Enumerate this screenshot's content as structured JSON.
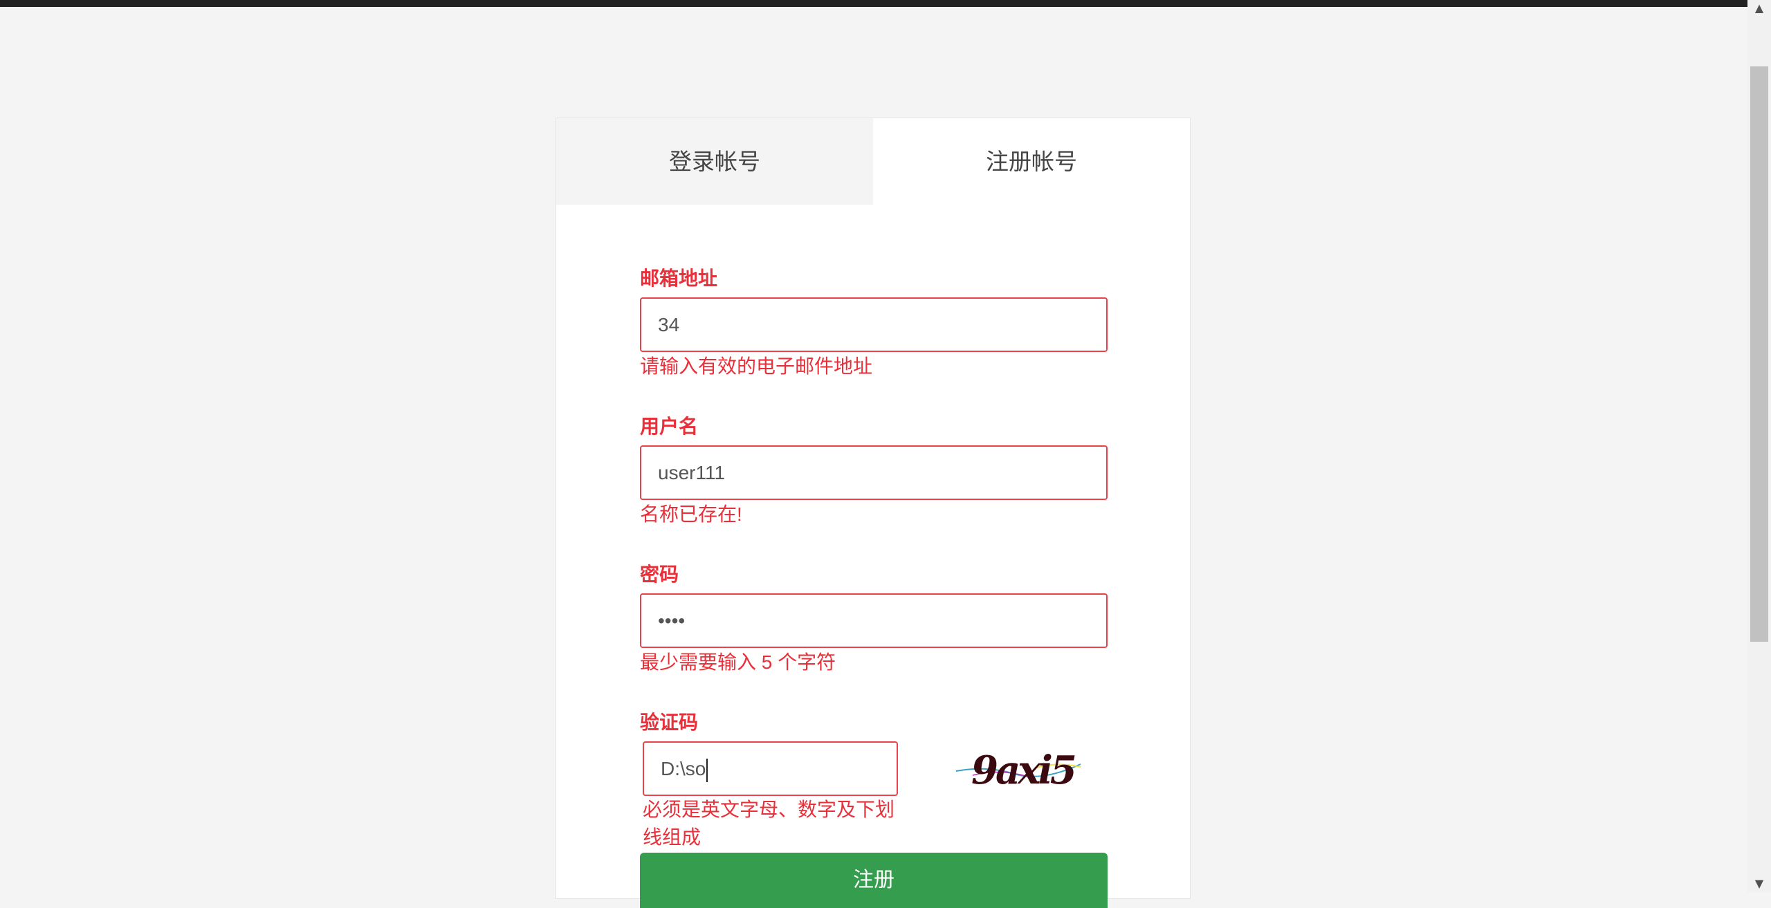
{
  "tabs": [
    {
      "label": "登录帐号"
    },
    {
      "label": "注册帐号"
    }
  ],
  "form": {
    "email": {
      "label": "邮箱地址",
      "value": "34",
      "error": "请输入有效的电子邮件地址"
    },
    "username": {
      "label": "用户名",
      "value": "user111",
      "error": "名称已存在!"
    },
    "password": {
      "label": "密码",
      "value": "••••",
      "error": "最少需要输入 5 个字符"
    },
    "captcha": {
      "label": "验证码",
      "value": "D:\\so",
      "error": "必须是英文字母、数字及下划线组成",
      "image_text": "9axi5"
    },
    "submit_label": "注册"
  },
  "colors": {
    "error": "#e8303a",
    "submit": "#359e4e",
    "topbar": "#222222"
  }
}
